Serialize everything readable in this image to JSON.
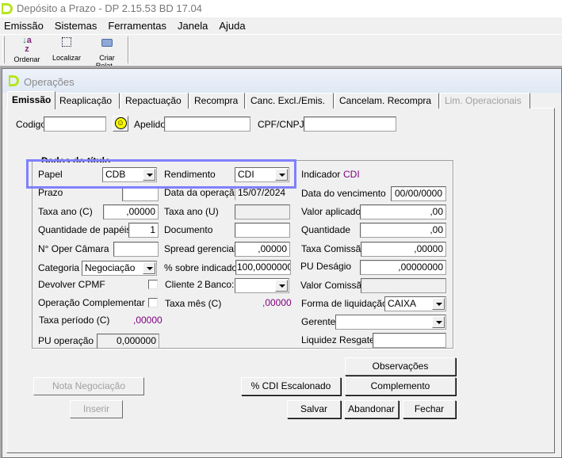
{
  "app": {
    "title": "Depósito a Prazo -  DP 2.15.53 BD 17.04"
  },
  "menu": [
    "Emissão",
    "Sistemas",
    "Ferramentas",
    "Janela",
    "Ajuda"
  ],
  "toolbar": [
    {
      "label": "Ordenar",
      "icon": "sort-az-icon"
    },
    {
      "label": "Localizar",
      "icon": "find-icon"
    },
    {
      "label": "Criar Relat...",
      "icon": "printer-icon"
    }
  ],
  "window": {
    "title": "Operações"
  },
  "tabs": [
    "Emissão",
    "Reaplicação",
    "Repactuação",
    "Recompra",
    "Canc. Excl./Emis.",
    "Cancelam. Recompra",
    "Lim. Operacionais"
  ],
  "active_tab": "Emissão",
  "header": {
    "codigo_label": "Codigo",
    "codigo_value": "",
    "apelido_label": "Apelido",
    "apelido_value": "",
    "cpf_label": "CPF/CNPJ",
    "cpf_value": ""
  },
  "group": {
    "title": "Dados do título"
  },
  "left": {
    "papel_label": "Papel",
    "papel_value": "CDB",
    "prazo_label": "Prazo",
    "prazo_value": "",
    "taxa_ano_c_label": "Taxa ano (C)",
    "taxa_ano_c_value": ",00000",
    "qtd_papeis_label": "Quantidade de papéis",
    "qtd_papeis_value": "1",
    "noper_label": "N° Oper Câmara",
    "noper_value": "",
    "categoria_label": "Categoria",
    "categoria_value": "Negociação",
    "cpmf_label": "Devolver CPMF",
    "cpmf_checked": false,
    "opcomp_label": "Operação Complementar",
    "opcomp_checked": false,
    "taxa_periodo_label": "Taxa período (C)",
    "taxa_periodo_value": ",00000",
    "pu_operacao_label": "PU operação",
    "pu_operacao_value": "0,000000"
  },
  "mid": {
    "rendimento_label": "Rendimento",
    "rendimento_value": "CDI",
    "data_operacao_label": "Data da operação",
    "data_operacao_value": "15/07/2024",
    "taxa_ano_u_label": "Taxa ano (U)",
    "taxa_ano_u_value": "",
    "documento_label": "Documento",
    "documento_value": "",
    "spread_label": "Spread gerencial",
    "spread_value": ",00000",
    "pct_indicador_label": "% sobre indicador",
    "pct_indicador_value": "100,0000000",
    "cliente2_label": "Cliente 2",
    "banco_label": "Banco:",
    "banco_value": "",
    "taxa_mes_label": "Taxa mês (C)",
    "taxa_mes_value": ",00000"
  },
  "right": {
    "indicador_label": "Indicador",
    "indicador_value": "CDI",
    "vencimento_label": "Data do vencimento",
    "vencimento_value": "00/00/0000",
    "valor_aplicado_label": "Valor aplicado",
    "valor_aplicado_value": ",00",
    "quantidade_label": "Quantidade",
    "quantidade_value": ",00",
    "taxa_comissao_label": "Taxa Comissão",
    "taxa_comissao_value": ",00000",
    "pu_desagio_label": "PU Deságio",
    "pu_desagio_value": ",00000000",
    "valor_comissao_label": "Valor Comissão",
    "valor_comissao_value": "",
    "liquidacao_label": "Forma de liquidação",
    "liquidacao_value": "CAIXA",
    "gerente_label": "Gerente",
    "gerente_value": "",
    "liquidez_label": "Liquidez Resgate",
    "liquidez_value": ""
  },
  "buttons": {
    "observacoes": "Observações",
    "complemento": "Complemento",
    "cdi_escalonado": "% CDI Escalonado",
    "nota": "Nota Negociação",
    "inserir": "Inserir",
    "salvar": "Salvar",
    "abandonar": "Abandonar",
    "fechar": "Fechar"
  },
  "colors": {
    "highlight": "#8080ff",
    "value_purple": "#800080",
    "logo": "#b5e61d"
  }
}
